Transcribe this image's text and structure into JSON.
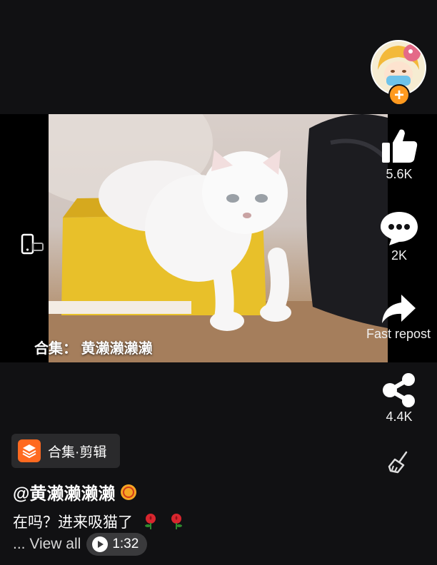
{
  "video": {
    "caption": "合集： 黄濑濑濑濑",
    "rotate_icon": "rotate-screen-icon"
  },
  "rail": {
    "like_count": "5.6K",
    "comment_count": "2K",
    "repost_label": "Fast repost",
    "share_count": "4.4K",
    "follow_symbol": "+"
  },
  "info": {
    "collection_label": "合集·剪辑",
    "username": "@黄濑濑濑濑",
    "description": "在吗？进来吸猫了",
    "view_all": "... View all",
    "duration": "1:32"
  },
  "colors": {
    "background": "#111113",
    "accent_orange": "#ff9a1f",
    "chip_orange": "#ff6a20"
  }
}
